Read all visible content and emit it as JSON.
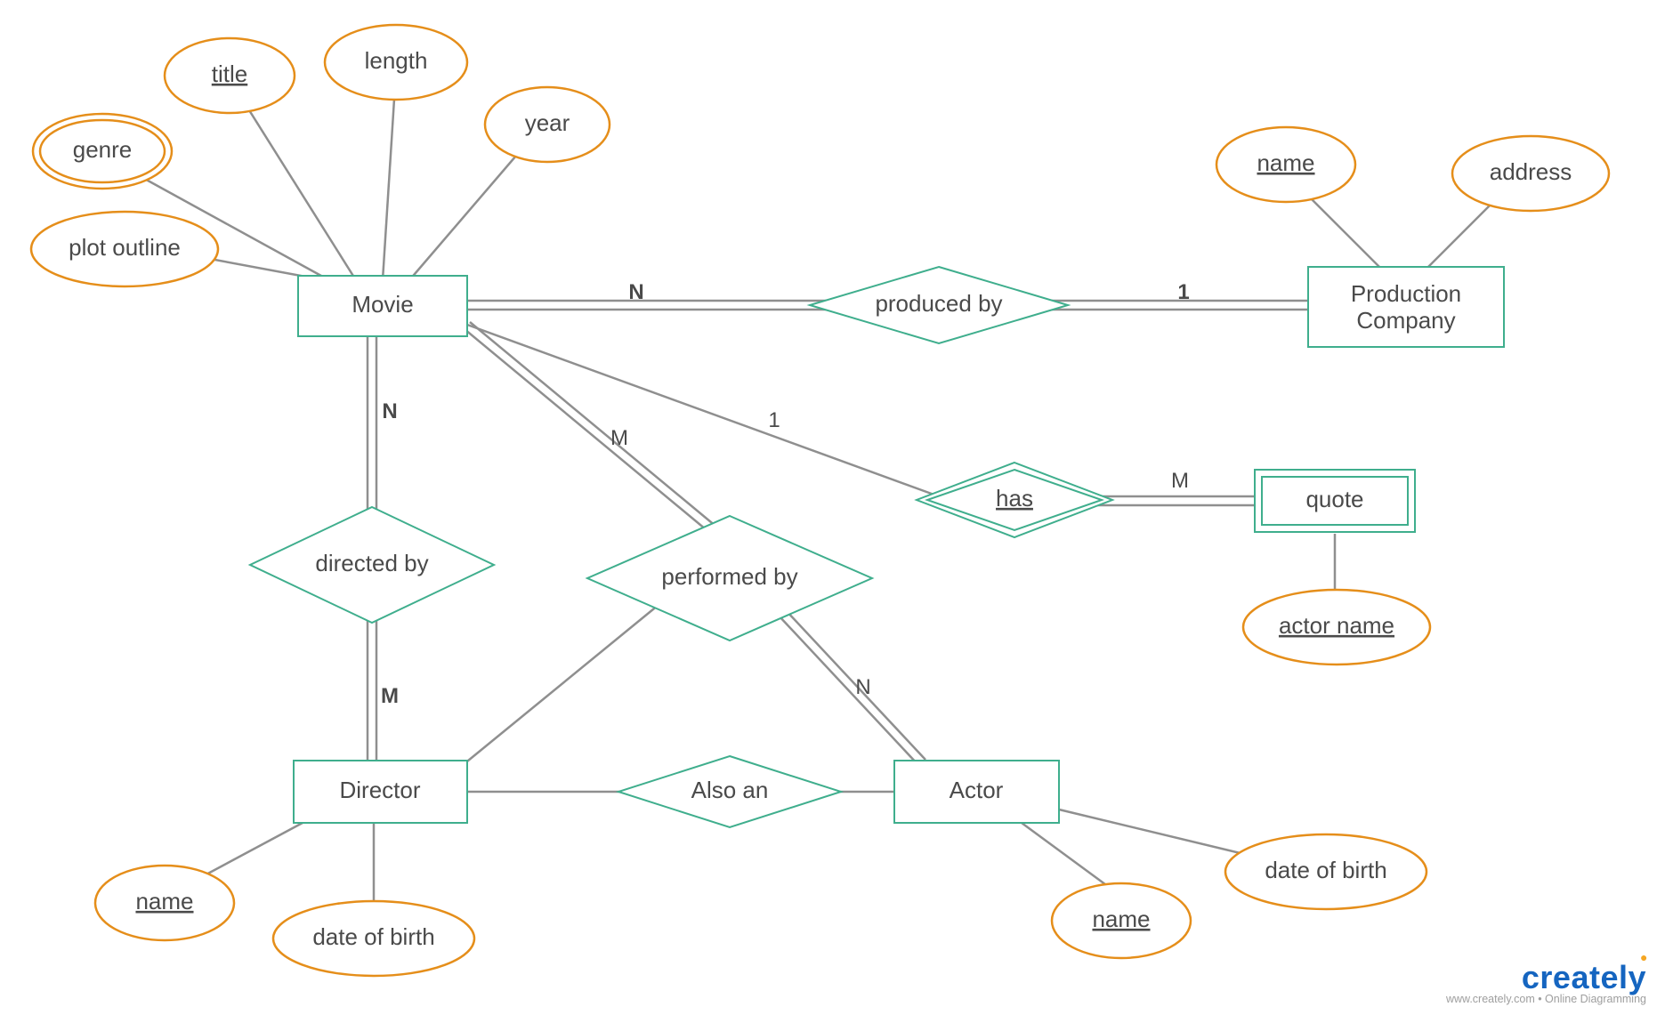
{
  "diagram": {
    "type": "ER Diagram",
    "entities": {
      "movie": {
        "label": "Movie",
        "attributes": [
          "title",
          "length",
          "year",
          "genre",
          "plot outline"
        ]
      },
      "production_company": {
        "label": "Production Company",
        "attributes": [
          "name",
          "address"
        ]
      },
      "director": {
        "label": "Director",
        "attributes": [
          "name",
          "date of birth"
        ]
      },
      "actor": {
        "label": "Actor",
        "attributes": [
          "name",
          "date of birth"
        ]
      },
      "quote": {
        "label": "quote",
        "weak": true,
        "attributes": [
          "actor name"
        ]
      }
    },
    "relationships": {
      "produced_by": {
        "label": "produced by",
        "left_card": "N",
        "right_card": "1"
      },
      "directed_by": {
        "label": "directed by",
        "top_card": "N",
        "bottom_card": "M"
      },
      "performed_by": {
        "label": "performed by",
        "top_card": "M",
        "bottom_card": "N"
      },
      "has": {
        "label": "has",
        "left_card": "1",
        "right_card": "M",
        "identifying": true
      },
      "also_an": {
        "label": "Also an"
      }
    },
    "attributes": {
      "title": {
        "label": "title",
        "key": true
      },
      "length": {
        "label": "length"
      },
      "year": {
        "label": "year"
      },
      "genre": {
        "label": "genre",
        "multivalued": true
      },
      "plot_outline": {
        "label": "plot outline"
      },
      "pc_name": {
        "label": "name",
        "key": true
      },
      "pc_address": {
        "label": "address"
      },
      "dir_name": {
        "label": "name",
        "key": true
      },
      "dir_dob": {
        "label": "date of birth"
      },
      "actor_name": {
        "label": "name",
        "key": true
      },
      "actor_dob": {
        "label": "date of birth"
      },
      "quote_actor_name": {
        "label": "actor name",
        "key": true
      }
    }
  },
  "watermark": {
    "brand": "creately",
    "sub": "www.creately.com • Online Diagramming"
  }
}
